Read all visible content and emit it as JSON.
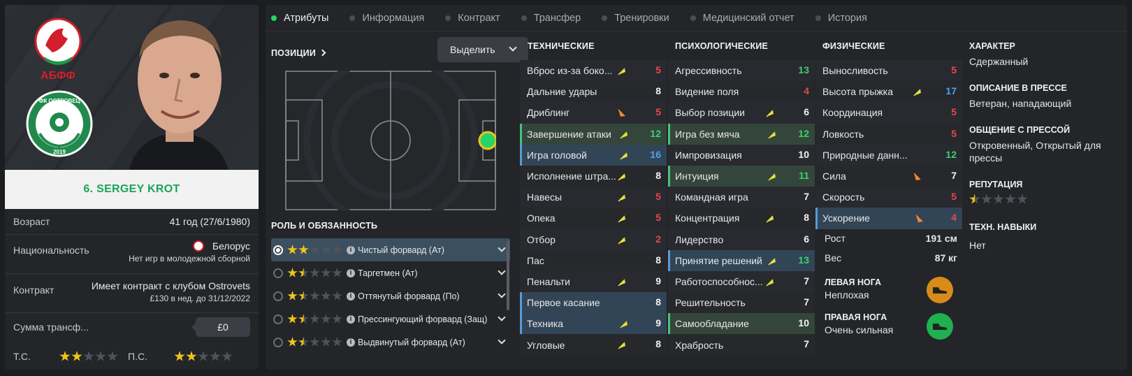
{
  "player": {
    "name": "6. SERGEY KROT",
    "crest_top_text": "АБФФ",
    "crest_club_text": "ФК ОСТРОВЕЦ",
    "crest_club_year": "2019",
    "age_label": "Возраст",
    "age_value": "41 год (27/6/1980)",
    "nationality_label": "Национальность",
    "nationality_value": "Белорус",
    "nationality_sub": "Нет игр в молодежной сборной",
    "contract_label": "Контракт",
    "contract_value": "Имеет контракт с клубом Ostrovets",
    "contract_sub": "£130 в нед. до 31/12/2022",
    "transfer_label": "Сумма трансф...",
    "transfer_value": "£0",
    "ca_label": "Т.С.",
    "ca_stars": 2,
    "pa_label": "П.С.",
    "pa_stars": 2
  },
  "tabs": [
    {
      "label": "Атрибуты",
      "active": true
    },
    {
      "label": "Информация",
      "active": false
    },
    {
      "label": "Контракт",
      "active": false
    },
    {
      "label": "Трансфер",
      "active": false
    },
    {
      "label": "Тренировки",
      "active": false
    },
    {
      "label": "Медицинский отчет",
      "active": false
    },
    {
      "label": "История",
      "active": false
    }
  ],
  "positions": {
    "title": "ПОЗИЦИИ",
    "select_label": "Выделить"
  },
  "roles_section": {
    "title": "РОЛЬ И ОБЯЗАННОСТЬ",
    "roles": [
      {
        "name": "Чистый форвард (Ат)",
        "stars": 2,
        "selected": true
      },
      {
        "name": "Таргетмен (Ат)",
        "stars": 1.5,
        "selected": false
      },
      {
        "name": "Оттянутый форвард (По)",
        "stars": 1.5,
        "selected": false
      },
      {
        "name": "Прессингующий форвард (Защ)",
        "stars": 1.5,
        "selected": false
      },
      {
        "name": "Выдвинутый форвард (Ат)",
        "stars": 1.5,
        "selected": false
      }
    ]
  },
  "technical": {
    "title": "ТЕХНИЧЕСКИЕ",
    "attrs": [
      {
        "name": "Вброс из-за боко...",
        "value": "5",
        "color": "red",
        "arrow": "up",
        "hl": ""
      },
      {
        "name": "Дальние удары",
        "value": "8",
        "color": "white",
        "arrow": "",
        "hl": ""
      },
      {
        "name": "Дриблинг",
        "value": "5",
        "color": "red",
        "arrow": "down",
        "hl": ""
      },
      {
        "name": "Завершение атаки",
        "value": "12",
        "color": "green",
        "arrow": "up",
        "hl": "green"
      },
      {
        "name": "Игра головой",
        "value": "16",
        "color": "blue",
        "arrow": "up",
        "hl": "blue"
      },
      {
        "name": "Исполнение штра...",
        "value": "8",
        "color": "white",
        "arrow": "up",
        "hl": ""
      },
      {
        "name": "Навесы",
        "value": "5",
        "color": "red",
        "arrow": "up",
        "hl": ""
      },
      {
        "name": "Опека",
        "value": "5",
        "color": "red",
        "arrow": "up",
        "hl": ""
      },
      {
        "name": "Отбор",
        "value": "2",
        "color": "red",
        "arrow": "up",
        "hl": ""
      },
      {
        "name": "Пас",
        "value": "8",
        "color": "white",
        "arrow": "",
        "hl": ""
      },
      {
        "name": "Пенальти",
        "value": "9",
        "color": "white",
        "arrow": "up",
        "hl": ""
      },
      {
        "name": "Первое касание",
        "value": "8",
        "color": "white",
        "arrow": "",
        "hl": "blue"
      },
      {
        "name": "Техника",
        "value": "9",
        "color": "white",
        "arrow": "up",
        "hl": "blue"
      },
      {
        "name": "Угловые",
        "value": "8",
        "color": "white",
        "arrow": "up",
        "hl": ""
      }
    ]
  },
  "mental": {
    "title": "ПСИХОЛОГИЧЕСКИЕ",
    "attrs": [
      {
        "name": "Агрессивность",
        "value": "13",
        "color": "green",
        "arrow": "",
        "hl": ""
      },
      {
        "name": "Видение поля",
        "value": "4",
        "color": "red",
        "arrow": "",
        "hl": ""
      },
      {
        "name": "Выбор позиции",
        "value": "6",
        "color": "white",
        "arrow": "up",
        "hl": ""
      },
      {
        "name": "Игра без мяча",
        "value": "12",
        "color": "green",
        "arrow": "up",
        "hl": "green"
      },
      {
        "name": "Импровизация",
        "value": "10",
        "color": "white",
        "arrow": "",
        "hl": ""
      },
      {
        "name": "Интуиция",
        "value": "11",
        "color": "green",
        "arrow": "up",
        "hl": "green"
      },
      {
        "name": "Командная игра",
        "value": "7",
        "color": "white",
        "arrow": "",
        "hl": ""
      },
      {
        "name": "Концентрация",
        "value": "8",
        "color": "white",
        "arrow": "up",
        "hl": ""
      },
      {
        "name": "Лидерство",
        "value": "6",
        "color": "white",
        "arrow": "",
        "hl": ""
      },
      {
        "name": "Принятие решений",
        "value": "13",
        "color": "green",
        "arrow": "up",
        "hl": "blue"
      },
      {
        "name": "Работоспособнос...",
        "value": "7",
        "color": "white",
        "arrow": "up",
        "hl": ""
      },
      {
        "name": "Решительность",
        "value": "7",
        "color": "white",
        "arrow": "",
        "hl": ""
      },
      {
        "name": "Самообладание",
        "value": "10",
        "color": "white",
        "arrow": "",
        "hl": "green"
      },
      {
        "name": "Храбрость",
        "value": "7",
        "color": "white",
        "arrow": "",
        "hl": ""
      }
    ]
  },
  "physical": {
    "title": "ФИЗИЧЕСКИЕ",
    "attrs": [
      {
        "name": "Выносливость",
        "value": "5",
        "color": "red",
        "arrow": "",
        "hl": ""
      },
      {
        "name": "Высота прыжка",
        "value": "17",
        "color": "blue",
        "arrow": "up",
        "hl": ""
      },
      {
        "name": "Координация",
        "value": "5",
        "color": "red",
        "arrow": "",
        "hl": ""
      },
      {
        "name": "Ловкость",
        "value": "5",
        "color": "red",
        "arrow": "",
        "hl": ""
      },
      {
        "name": "Природные данн...",
        "value": "12",
        "color": "green",
        "arrow": "",
        "hl": ""
      },
      {
        "name": "Сила",
        "value": "7",
        "color": "white",
        "arrow": "down",
        "hl": ""
      },
      {
        "name": "Скорость",
        "value": "5",
        "color": "red",
        "arrow": "",
        "hl": ""
      },
      {
        "name": "Ускорение",
        "value": "4",
        "color": "red",
        "arrow": "down",
        "hl": "blue"
      }
    ],
    "height_label": "Рост",
    "height_value": "191 см",
    "weight_label": "Вес",
    "weight_value": "87 кг",
    "left_foot_label": "ЛЕВАЯ НОГА",
    "left_foot_value": "Неплохая",
    "right_foot_label": "ПРАВАЯ НОГА",
    "right_foot_value": "Очень сильная"
  },
  "character": {
    "personality_label": "ХАРАКТЕР",
    "personality_value": "Сдержанный",
    "media_desc_label": "ОПИСАНИЕ В ПРЕССЕ",
    "media_desc_value": "Ветеран, нападающий",
    "media_handling_label": "ОБЩЕНИЕ С ПРЕССОЙ",
    "media_handling_value": "Откровенный, Открытый для прессы",
    "reputation_label": "РЕПУТАЦИЯ",
    "reputation_stars": 0.5,
    "tech_skills_label": "ТЕХН. НАВЫКИ",
    "tech_skills_value": "Нет"
  },
  "colors": {
    "accent_green": "#27d46a",
    "attr_red": "#e5484d",
    "attr_green": "#3dd26f",
    "attr_blue": "#4ea3f3",
    "star_gold": "#f0c419",
    "left_foot_color": "#d98b1a",
    "right_foot_color": "#1fb04f"
  }
}
